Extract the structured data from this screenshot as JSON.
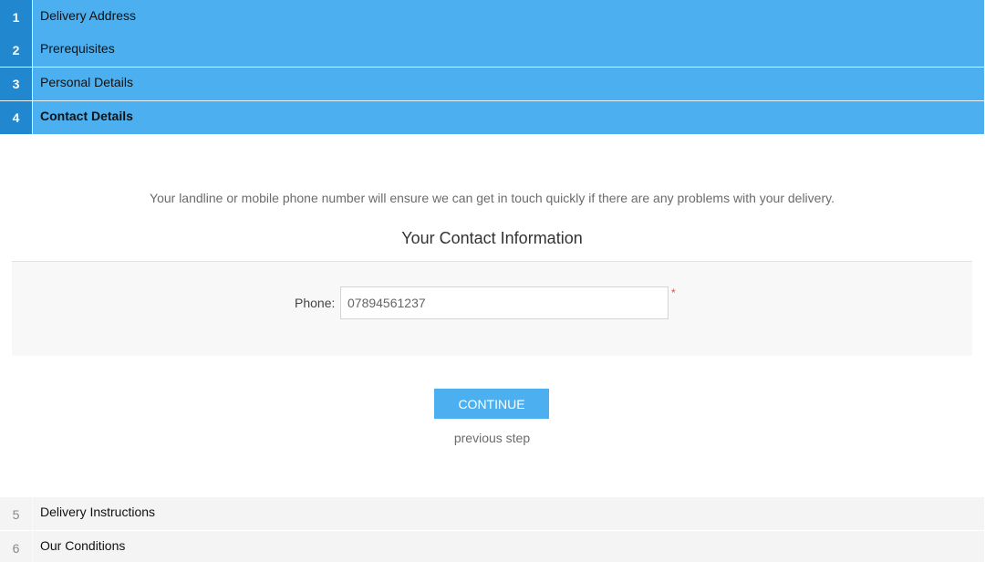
{
  "steps": [
    {
      "number": "1",
      "label": "Delivery Address",
      "state": "done"
    },
    {
      "number": "2",
      "label": "Prerequisites",
      "state": "done"
    },
    {
      "number": "3",
      "label": "Personal Details",
      "state": "done"
    },
    {
      "number": "4",
      "label": "Contact Details",
      "state": "current"
    },
    {
      "number": "5",
      "label": "Delivery Instructions",
      "state": "pending"
    },
    {
      "number": "6",
      "label": "Our Conditions",
      "state": "pending"
    }
  ],
  "contact": {
    "intro": "Your landline or mobile phone number will ensure we can get in touch quickly if there are any problems with your delivery.",
    "section_title": "Your Contact Information",
    "phone_label": "Phone:",
    "phone_value": "07894561237",
    "required_marker": "*",
    "continue_label": "CONTINUE",
    "previous_label": "previous step"
  },
  "colors": {
    "accent": "#4cb0f0",
    "accent_dark": "#2188cf",
    "required": "#e05050"
  }
}
